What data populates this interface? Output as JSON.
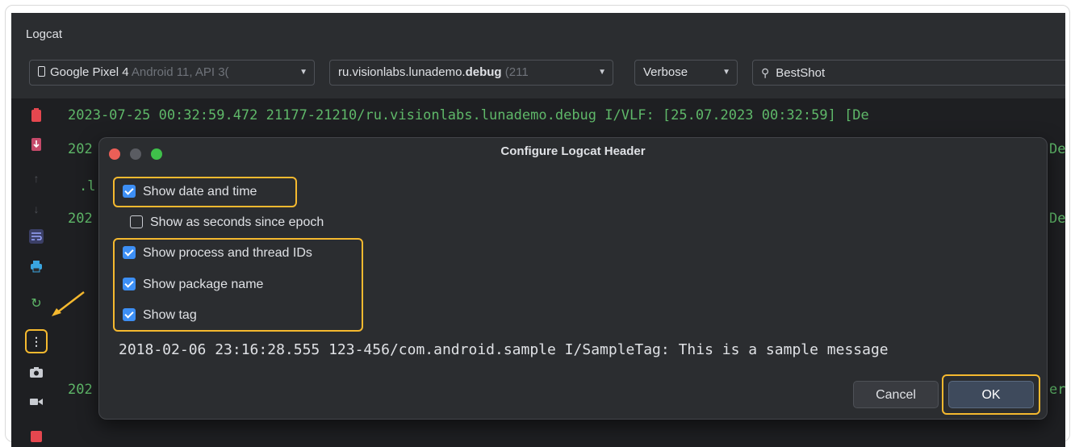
{
  "window": {
    "title": "Logcat"
  },
  "toolbar": {
    "device": {
      "name": "Google Pixel 4",
      "detail": "Android 11, API 3("
    },
    "package": {
      "prefix": "ru.visionlabs.lunademo.",
      "bold": "debug",
      "pid": "(211"
    },
    "level": "Verbose",
    "search": {
      "value": "BestShot"
    }
  },
  "log": {
    "lines": [
      "2023-07-25 00:32:59.472 21177-21210/ru.visionlabs.lunademo.debug I/VLF: [25.07.2023 00:32:59] [De",
      "202",
      ".l",
      "202",
      "202"
    ],
    "right_fragments": [
      "De",
      "De",
      "er"
    ]
  },
  "dialog": {
    "title": "Configure Logcat Header",
    "options": [
      {
        "label": "Show date and time",
        "checked": true
      },
      {
        "label": "Show as seconds since epoch",
        "checked": false
      },
      {
        "label": "Show process and thread IDs",
        "checked": true
      },
      {
        "label": "Show package name",
        "checked": true
      },
      {
        "label": "Show tag",
        "checked": true
      }
    ],
    "sample": "2018-02-06 23:16:28.555 123-456/com.android.sample I/SampleTag: This is a sample message",
    "cancel_label": "Cancel",
    "ok_label": "OK"
  },
  "sidebar": {
    "icons": [
      "clear-logcat-icon",
      "scroll-to-end-icon",
      "up-arrow-icon",
      "down-arrow-icon",
      "soft-wrap-icon",
      "print-icon",
      "restart-icon",
      "more-options-icon",
      "screenshot-icon",
      "screen-record-icon",
      "stop-icon"
    ]
  },
  "colors": {
    "background": "#1e1f22",
    "panel": "#2b2d30",
    "log_text": "#5fb869",
    "highlight": "#f5b92f",
    "checkbox": "#3d8ff5"
  }
}
